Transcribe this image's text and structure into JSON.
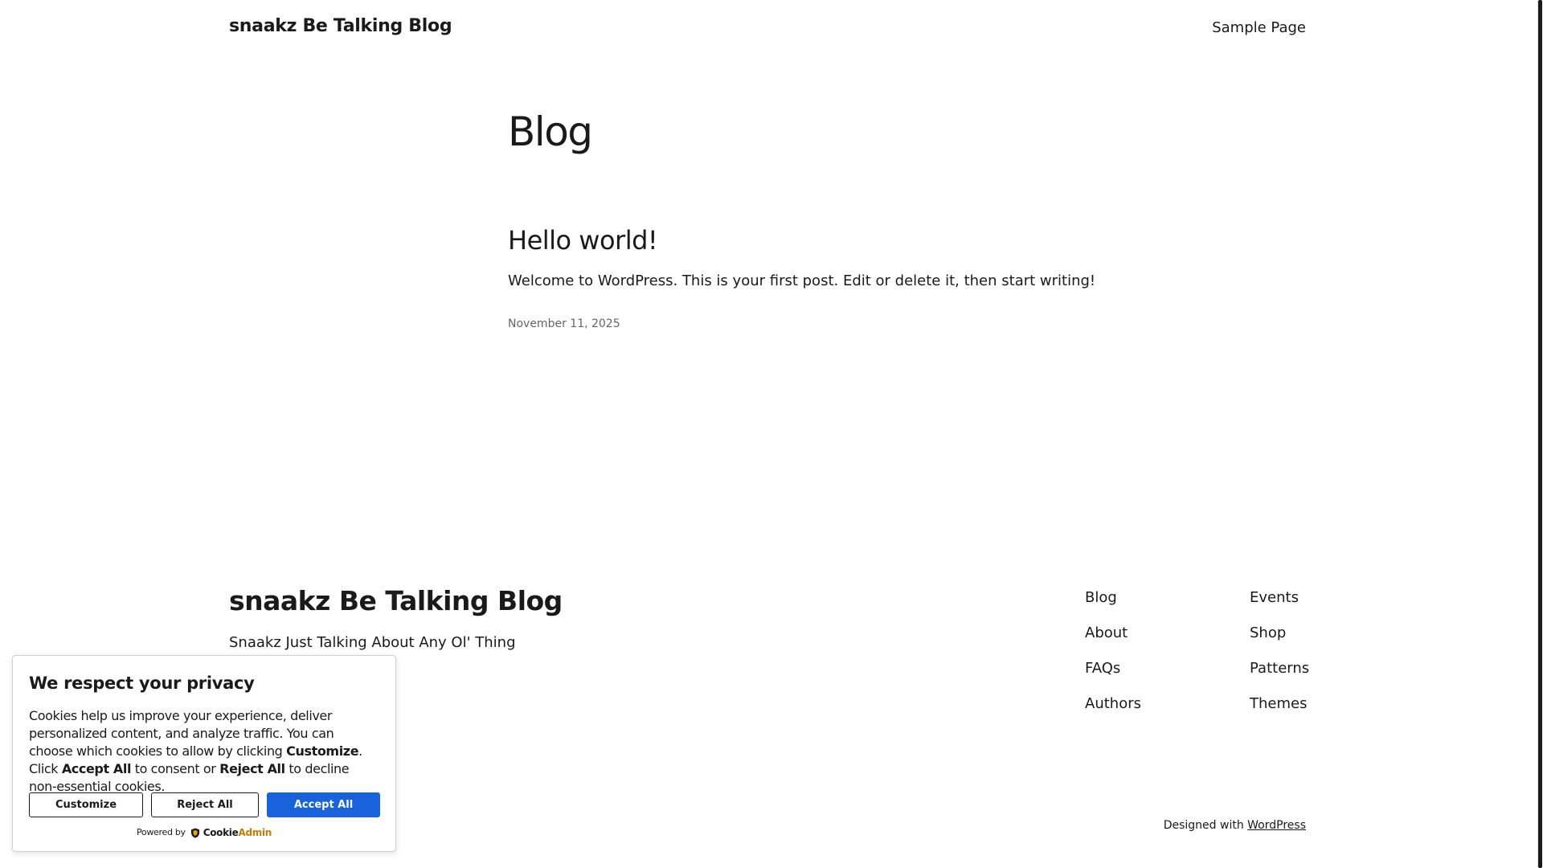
{
  "header": {
    "site_title": "snaakz Be Talking Blog",
    "nav_link": "Sample Page"
  },
  "main": {
    "page_heading": "Blog",
    "post": {
      "title": "Hello world!",
      "excerpt": "Welcome to WordPress. This is your first post. Edit or delete it, then start writing!",
      "date": "November 11, 2025"
    }
  },
  "footer": {
    "title": "snaakz Be Talking Blog",
    "tagline": "Snaakz Just Talking About Any Ol' Thing",
    "nav_col1": [
      "Blog",
      "About",
      "FAQs",
      "Authors"
    ],
    "nav_col2": [
      "Events",
      "Shop",
      "Patterns",
      "Themes"
    ],
    "credit_prefix": "Designed with",
    "credit_link": "WordPress"
  },
  "cookie_banner": {
    "heading": "We respect your privacy",
    "text_part1": "Cookies help us improve your experience, deliver personalized content, and analyze traffic. You can choose which cookies to allow by clicking ",
    "text_bold1": "Customize",
    "text_part2": ". Click ",
    "text_bold2": "Accept All",
    "text_part3": " to consent or ",
    "text_bold3": "Reject All",
    "text_part4": " to decline non-essential cookies.",
    "customize_label": "Customize",
    "reject_label": "Reject All",
    "accept_label": "Accept All",
    "powered_label": "Powered by",
    "brand_part1": "Cookie",
    "brand_part2": "Admin",
    "accent_color": "#1863dc"
  }
}
